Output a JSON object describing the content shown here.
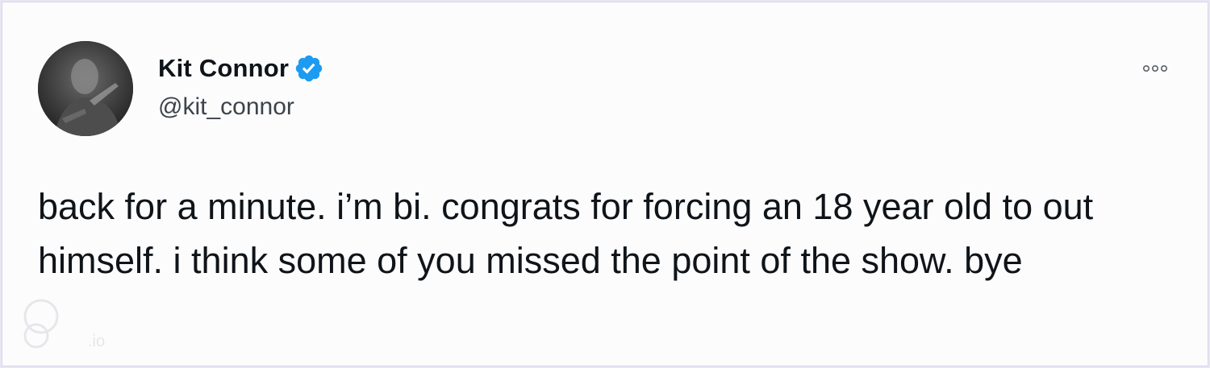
{
  "tweet": {
    "author": {
      "display_name": "Kit Connor",
      "handle": "@kit_connor",
      "verified": true,
      "verified_icon": "verified-badge-icon",
      "avatar_icon": "user-avatar"
    },
    "text": "back for a minute. i’m bi. congrats for forcing an 18 year old to out himself. i think some of you missed the point of the show. bye",
    "more_icon": "more-options-icon"
  },
  "watermark": {
    "text": ".io"
  },
  "colors": {
    "text_primary": "#0f1419",
    "verified_blue": "#1d9bf0",
    "background": "#fcfcfd",
    "frame": "#e9e6f4"
  }
}
